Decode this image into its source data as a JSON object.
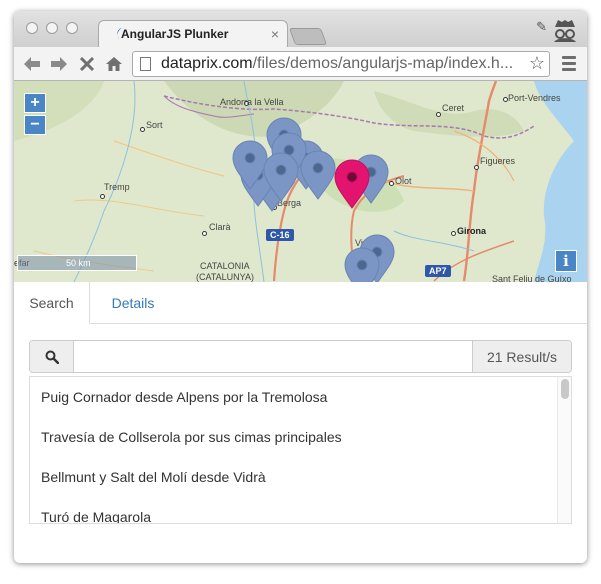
{
  "browser": {
    "tab_title": "AngularJS Plunker",
    "tab_close": "×",
    "url_host": "dataprix.com",
    "url_path": "/files/demos/angularjs-map/index.h...",
    "back_icon": "back-arrow-icon",
    "forward_icon": "forward-arrow-icon",
    "stop_icon": "close-icon",
    "home_icon": "home-icon",
    "star_icon": "star-icon",
    "menu_icon": "hamburger-menu-icon"
  },
  "map": {
    "zoom_in": "+",
    "zoom_out": "−",
    "scale_label": "50 km",
    "scale_left": "efar",
    "info": "i",
    "places": {
      "andorra": "Andorra la Vella",
      "ceret": "Ceret",
      "port_vendres": "Port-Vendres",
      "sort": "Sort",
      "figueres": "Figueres",
      "tremp": "Tremp",
      "olot": "Olot",
      "berga": "Berga",
      "clara": "Clarà",
      "girona": "Girona",
      "catalonia": "CATALONIA",
      "catalunya": "(CATALUNYA)",
      "vic": "Vi",
      "sant_feliu": "Sant Feliu de Guíxo",
      "c16": "C-16",
      "ap7": "AP7"
    },
    "colors": {
      "marker": "#7b96c4",
      "marker_selected": "#e3146f",
      "sea": "#a9d3ee",
      "land": "#dfe8cd"
    }
  },
  "panel": {
    "tabs": [
      {
        "label": "Search"
      },
      {
        "label": "Details"
      }
    ],
    "search_icon": "search-icon",
    "search_placeholder": "",
    "result_count": "21 Result/s",
    "results": [
      "Puig Cornador desde Alpens por la Tremolosa",
      "Travesía de Collserola por sus cimas principales",
      "Bellmunt y Salt del Molí desde Vidrà",
      "Turó de Magarola"
    ]
  }
}
